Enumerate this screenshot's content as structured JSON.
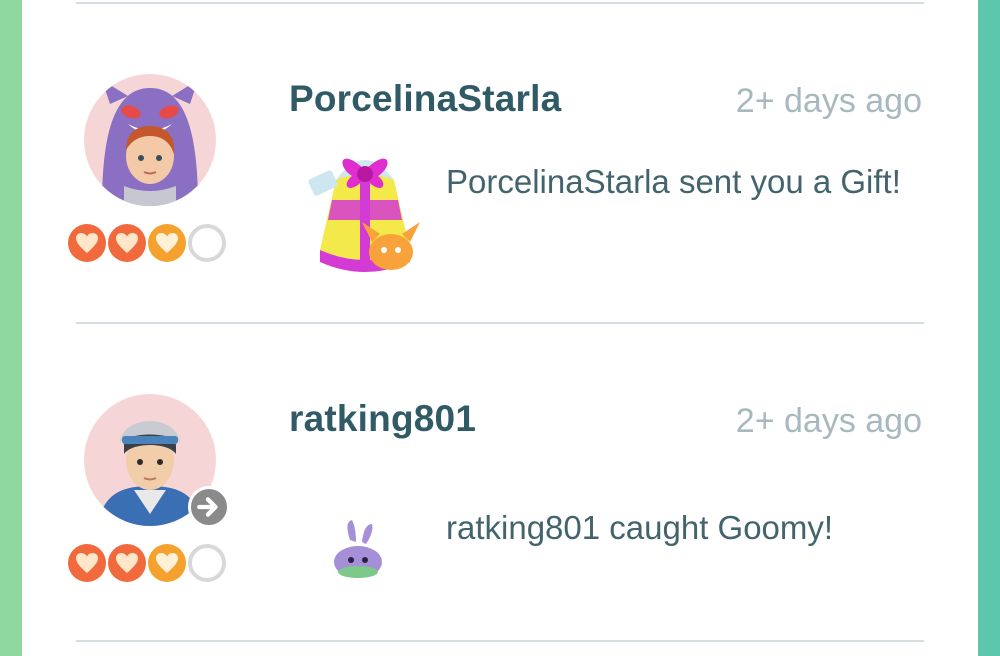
{
  "feed": {
    "entries": [
      {
        "name": "PorcelinaStarla",
        "time": "2+ days ago",
        "message": "PorcelinaStarla sent you a Gift!",
        "friendship_level": 3,
        "friendship_max": 4,
        "thumbnail_icon": "gift-icon",
        "avatar_icon": "gengar-hood-avatar"
      },
      {
        "name": "ratking801",
        "time": "2+ days ago",
        "message": "ratking801 caught Goomy!",
        "friendship_level": 3,
        "friendship_max": 4,
        "thumbnail_icon": "goomy-icon",
        "avatar_icon": "trainer-avatar",
        "badge_icon": "arrow-right-icon"
      }
    ]
  },
  "colors": {
    "name": "#2f5a66",
    "time": "#a7b9bf",
    "message": "#43646d",
    "heart_red": "#f06a3d",
    "heart_orange": "#f5a12e",
    "heart_empty": "#d8d8d8",
    "left_edge": "#8fd9a0",
    "right_edge": "#5cc7ac"
  }
}
